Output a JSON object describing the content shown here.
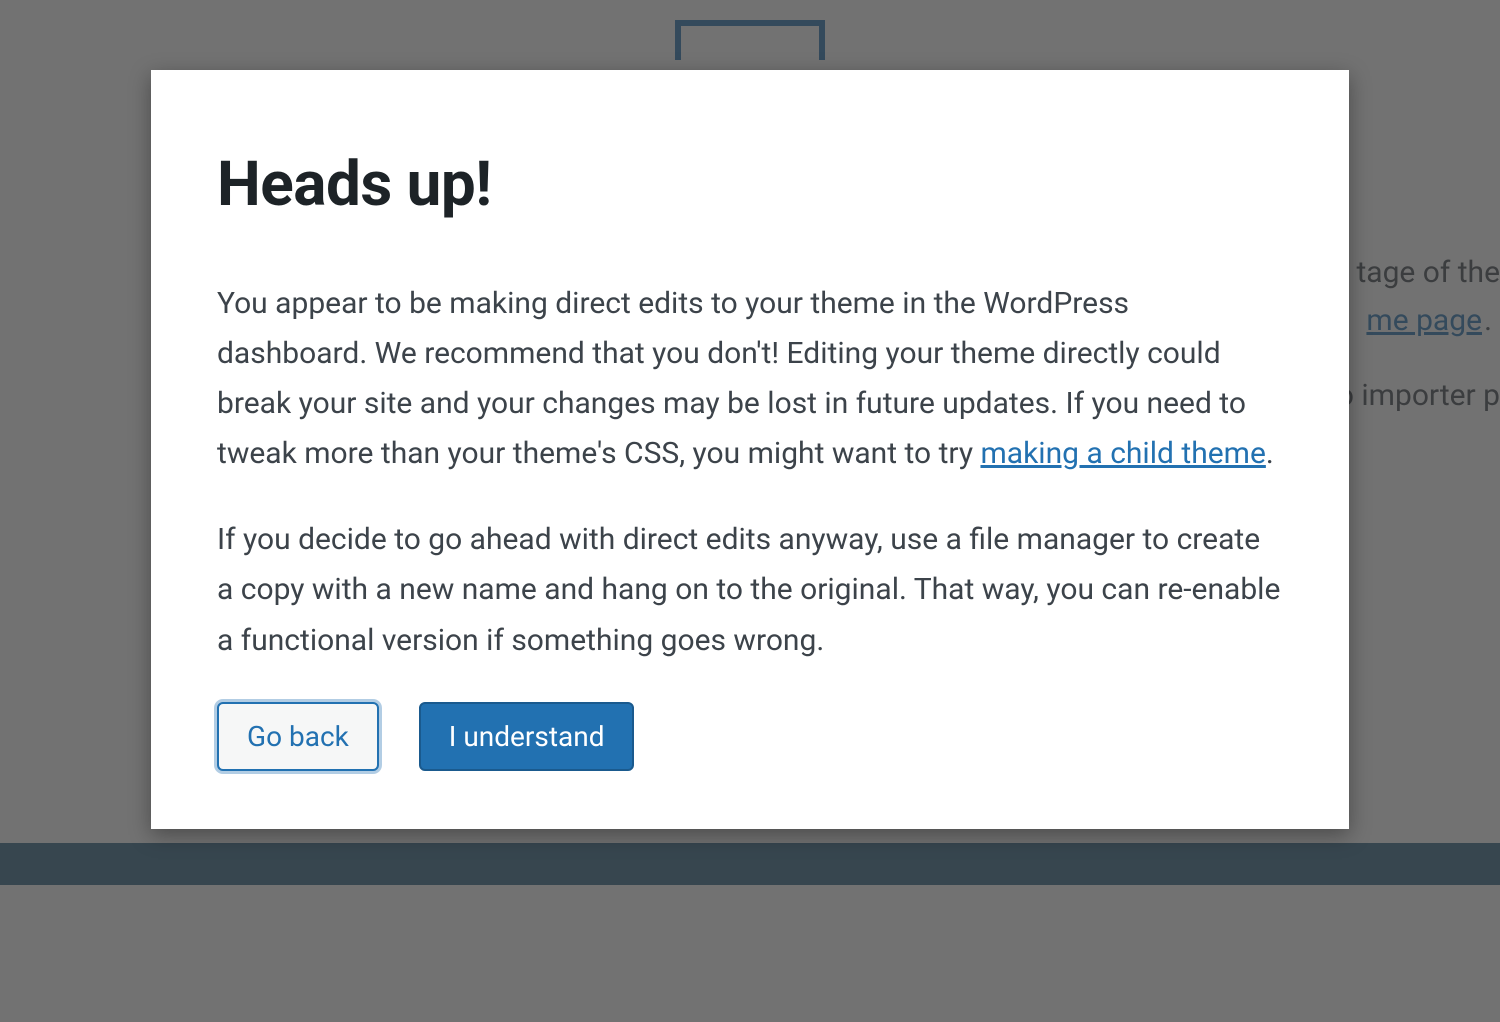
{
  "background": {
    "text1": "tage of the",
    "link1": "me page",
    "period1": ".",
    "text2": "o importer p"
  },
  "modal": {
    "title": "Heads up!",
    "paragraph1_pre": "You appear to be making direct edits to your theme in the WordPress dashboard. We recommend that you don't! Editing your theme directly could break your site and your changes may be lost in future updates. If you need to tweak more than your theme's CSS, you might want to try ",
    "paragraph1_link": "making a child theme",
    "paragraph1_post": ".",
    "paragraph2": "If you decide to go ahead with direct edits anyway, use a file manager to create a copy with a new name and hang on to the original. That way, you can re-enable a functional version if something goes wrong.",
    "buttons": {
      "go_back": "Go back",
      "i_understand": "I understand"
    }
  }
}
